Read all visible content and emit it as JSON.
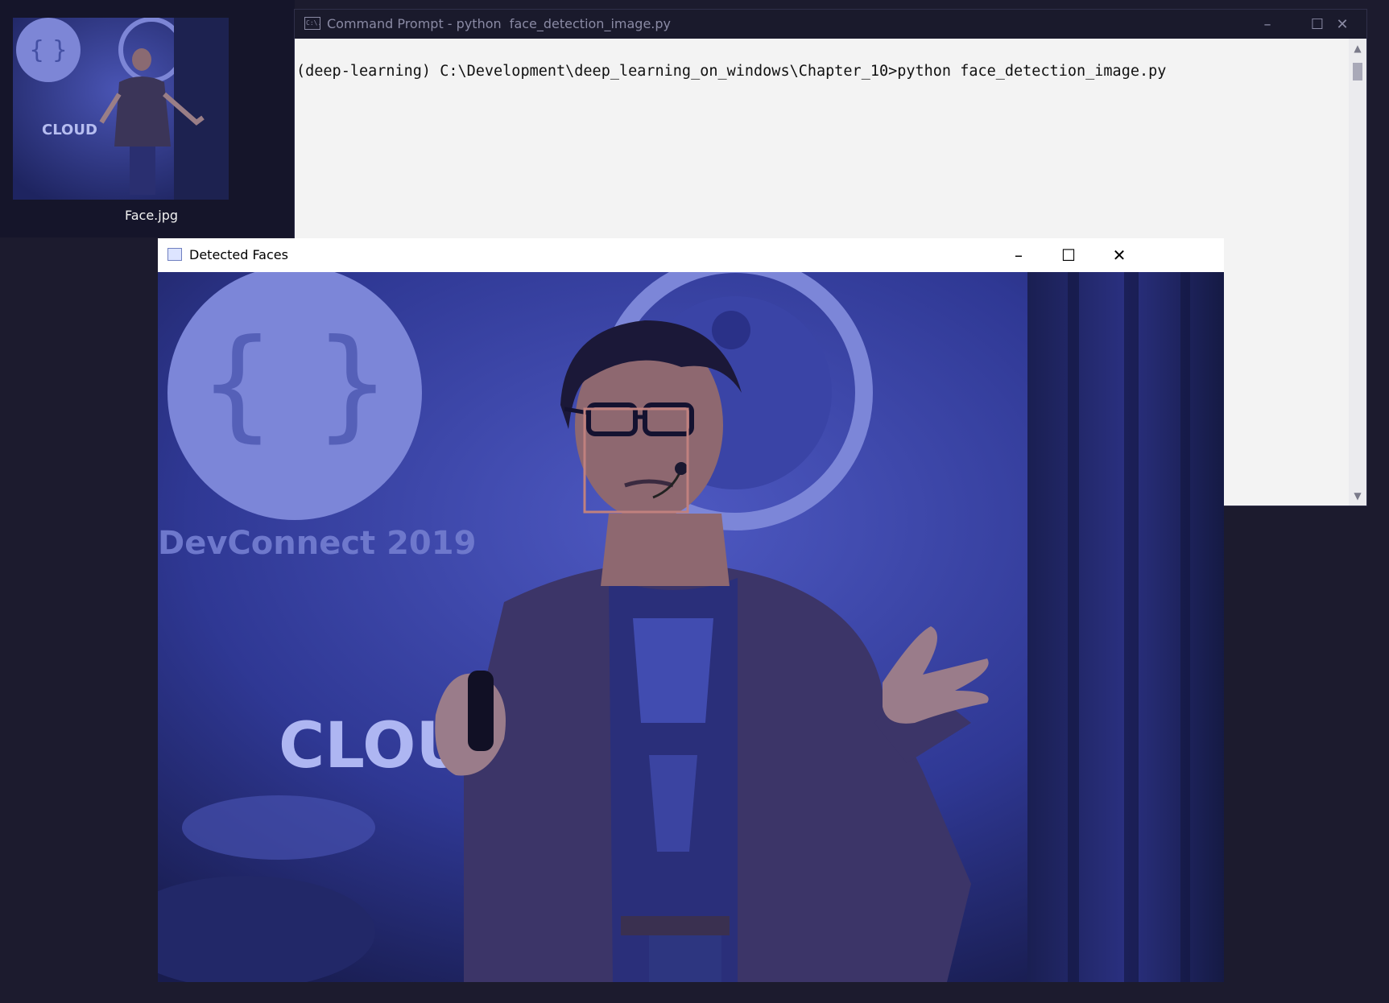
{
  "desktop": {
    "thumbnail_label": "Face.jpg"
  },
  "cmd_window": {
    "title": "Command Prompt - python  face_detection_image.py",
    "icon_text": "C:\\.",
    "prompt_line": "(deep-learning) C:\\Development\\deep_learning_on_windows\\Chapter_10>python face_detection_image.py",
    "controls": {
      "minimize": "–",
      "maximize": "☐",
      "close": "✕"
    },
    "scroll_up": "▲",
    "scroll_down": "▼"
  },
  "faces_window": {
    "title": "Detected Faces",
    "controls": {
      "minimize": "–",
      "maximize": "☐",
      "close": "✕"
    },
    "image_text": {
      "banner": "DevConnect 2019",
      "cloud": "CLOUD"
    },
    "detection_box_color": "#c0817e"
  },
  "colors": {
    "desktop_bg": "#1c1b2e",
    "image_tint": "#2e3790",
    "cmd_bg": "#f3f3f3"
  }
}
